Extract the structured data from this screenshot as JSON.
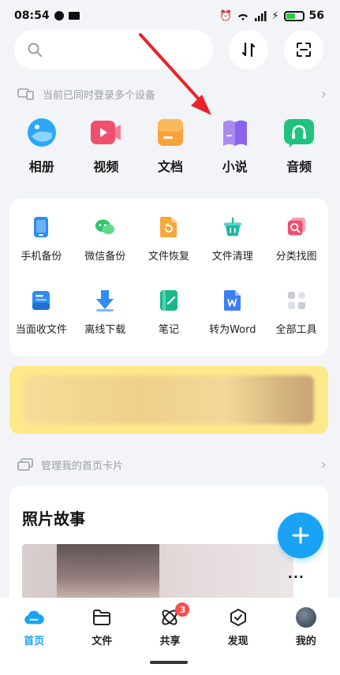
{
  "status_bar": {
    "time": "08:54",
    "battery": "56",
    "battery_level": 0.56,
    "icons": [
      "message-dot-icon",
      "mail-icon",
      "alarm-icon",
      "wifi-icon",
      "signal-icon",
      "charging-icon",
      "battery-icon"
    ]
  },
  "search": {
    "placeholder": "",
    "icon": "search-icon"
  },
  "header_actions": {
    "transfer_icon": "transfer-arrows-icon",
    "scan_icon": "scan-icon"
  },
  "devices_row": {
    "text": "当前已同时登录多个设备",
    "icon": "devices-icon"
  },
  "main_categories": [
    {
      "label": "相册",
      "icon": "album-icon",
      "color": "#2ba7f5"
    },
    {
      "label": "视频",
      "icon": "video-icon",
      "color": "#f0506e"
    },
    {
      "label": "文档",
      "icon": "document-icon",
      "color": "#f9a23b"
    },
    {
      "label": "小说",
      "icon": "novel-icon",
      "color": "#8a63e8"
    },
    {
      "label": "音频",
      "icon": "audio-icon",
      "color": "#1fc37f"
    }
  ],
  "tools": [
    {
      "label": "手机备份",
      "icon": "phone-backup-icon",
      "color": "#2f8cf0"
    },
    {
      "label": "微信备份",
      "icon": "wechat-backup-icon",
      "color": "#2ec46a"
    },
    {
      "label": "文件恢复",
      "icon": "file-recovery-icon",
      "color": "#f6a83b"
    },
    {
      "label": "文件清理",
      "icon": "file-clean-icon",
      "color": "#1bb7a3"
    },
    {
      "label": "分类找图",
      "icon": "find-image-icon",
      "color": "#f24d6b"
    },
    {
      "label": "当面收文件",
      "icon": "receive-file-icon",
      "color": "#2f8cf0"
    },
    {
      "label": "离线下载",
      "icon": "offline-download-icon",
      "color": "#2f8cf0"
    },
    {
      "label": "笔记",
      "icon": "note-icon",
      "color": "#1bb78b"
    },
    {
      "label": "转为Word",
      "icon": "word-icon",
      "color": "#3d7ef5"
    },
    {
      "label": "全部工具",
      "icon": "all-tools-icon",
      "color": "#c9ced6"
    }
  ],
  "manage_row": {
    "text": "管理我的首页卡片",
    "icon": "cards-icon"
  },
  "story_card": {
    "title": "照片故事",
    "more": "···"
  },
  "fab": {
    "icon": "plus-icon"
  },
  "tabs": [
    {
      "label": "首页",
      "icon": "home-cloud-icon",
      "active": true
    },
    {
      "label": "文件",
      "icon": "folder-icon",
      "active": false
    },
    {
      "label": "共享",
      "icon": "share-icon",
      "active": false,
      "badge": "3"
    },
    {
      "label": "发现",
      "icon": "discover-icon",
      "active": false
    },
    {
      "label": "我的",
      "icon": "avatar",
      "active": false
    }
  ],
  "accent_color": "#1aa3f5"
}
